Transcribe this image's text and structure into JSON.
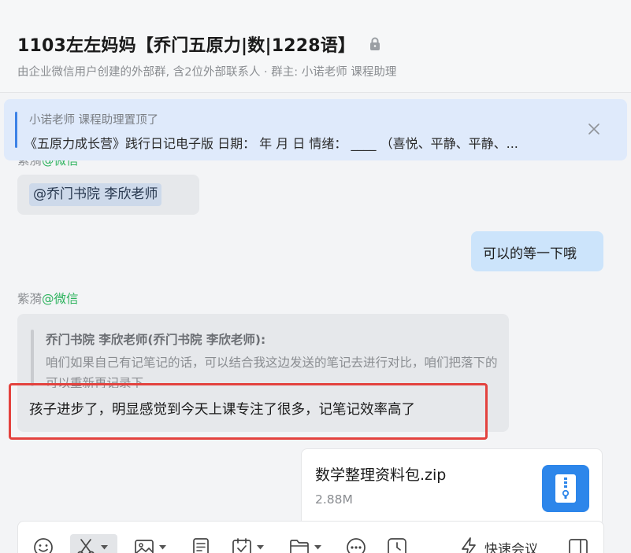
{
  "header": {
    "title": "1103左左妈妈【乔门五原力|数|1228语】",
    "subtitle": "由企业微信用户创建的外部群, 含2位外部联系人 · 群主: 小诺老师 课程助理"
  },
  "pinned": {
    "by": "小诺老师 课程助理置顶了",
    "text": "《五原力成长营》践行日记电子版 日期：     年   月   日  情绪：  ____  （喜悦、平静、平静、..."
  },
  "messages": {
    "m1": {
      "sender": "紫漪",
      "source": "@微信",
      "mention": "@乔门书院 李欣老师"
    },
    "m2": {
      "text": "可以的等一下哦"
    },
    "m3": {
      "sender": "紫漪",
      "source": "@微信",
      "quote_author": "乔门书院 李欣老师(乔门书院 李欣老师):",
      "quote_text": "咱们如果自己有记笔记的话，可以结合我这边发送的笔记去进行对比，咱们把落下的可以重新再记录下",
      "reply": "孩子进步了，明显感觉到今天上课专注了很多，记笔记效率高了"
    },
    "file": {
      "name": "数学整理资料包.zip",
      "size": "2.88M"
    }
  },
  "toolbar": {
    "meeting_label": "快速会议",
    "icons": [
      "emoji-icon",
      "scissors-icon",
      "image-icon",
      "document-icon",
      "calendar-check-icon",
      "folder-icon",
      "more-dots-icon",
      "clock-icon",
      "lightning-icon",
      "sidebar-panel-icon"
    ]
  },
  "colors": {
    "accent": "#2d86ea",
    "pinned_bg": "#dfeafb",
    "wechat_green": "#2eb35e",
    "highlight_red": "#e3423e",
    "bubble_self": "#cce4fb",
    "bubble_other": "#e6e8eb"
  }
}
